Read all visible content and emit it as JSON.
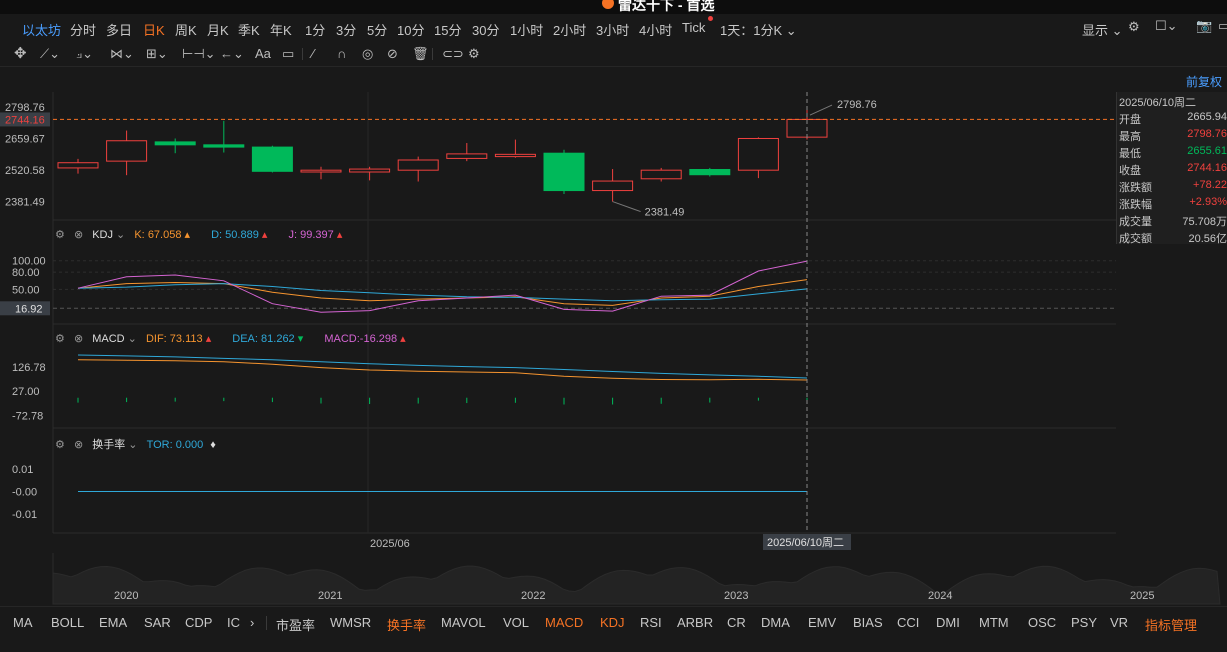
{
  "window": {
    "title": "雷达十下 - 首选"
  },
  "period_bar": {
    "symbol": "以太坊",
    "items": [
      "分时",
      "多日",
      "日K",
      "周K",
      "月K",
      "季K",
      "年K",
      "1分",
      "3分",
      "5分",
      "10分",
      "15分",
      "30分",
      "1小时",
      "2小时",
      "3小时",
      "4小时",
      "Tick"
    ],
    "active": "日K",
    "sync": "1天：1分K",
    "display": "显示"
  },
  "toolbar": {
    "icons": [
      "move-icon",
      "line-icon",
      "trend-icon",
      "wave-icon",
      "fib-icon",
      "measure-icon",
      "arrow-icon",
      "text-icon",
      "comment-icon",
      "pen-icon",
      "magnet-icon",
      "eye-icon",
      "hide-icon",
      "delete-icon",
      "link-icon",
      "settings-icon"
    ]
  },
  "main_chart": {
    "adjust_label": "前复权",
    "price_labels": [
      "2798.76",
      "2744.16",
      "2659.67",
      "2520.58",
      "2381.49"
    ],
    "current_price": "2744.16",
    "high_label": "2798.76",
    "low_label": "2381.49",
    "colors": {
      "up": "#f0413e",
      "down": "#00b95a",
      "background": "#191919"
    }
  },
  "chart_data": [
    {
      "type": "candlestick",
      "title": "",
      "ylim": [
        2300,
        2830
      ],
      "candles": [
        {
          "o": 2530,
          "h": 2570,
          "l": 2505,
          "c": 2553
        },
        {
          "o": 2560,
          "h": 2695,
          "l": 2498,
          "c": 2650
        },
        {
          "o": 2645,
          "h": 2660,
          "l": 2595,
          "c": 2632
        },
        {
          "o": 2632,
          "h": 2738,
          "l": 2598,
          "c": 2622
        },
        {
          "o": 2622,
          "h": 2628,
          "l": 2510,
          "c": 2515
        },
        {
          "o": 2512,
          "h": 2535,
          "l": 2480,
          "c": 2520
        },
        {
          "o": 2512,
          "h": 2535,
          "l": 2475,
          "c": 2525
        },
        {
          "o": 2520,
          "h": 2580,
          "l": 2470,
          "c": 2565
        },
        {
          "o": 2572,
          "h": 2640,
          "l": 2560,
          "c": 2592
        },
        {
          "o": 2580,
          "h": 2655,
          "l": 2575,
          "c": 2590
        },
        {
          "o": 2595,
          "h": 2610,
          "l": 2415,
          "c": 2430
        },
        {
          "o": 2430,
          "h": 2525,
          "l": 2381.49,
          "c": 2472
        },
        {
          "o": 2482,
          "h": 2530,
          "l": 2470,
          "c": 2520
        },
        {
          "o": 2523,
          "h": 2530,
          "l": 2492,
          "c": 2500
        },
        {
          "o": 2520,
          "h": 2665,
          "l": 2485,
          "c": 2660
        },
        {
          "o": 2665.94,
          "h": 2798.76,
          "l": 2655.61,
          "c": 2744.16
        }
      ]
    },
    {
      "type": "line",
      "title": "KDJ",
      "ylim": [
        0,
        110
      ],
      "ticks": [
        "100.00",
        "80.00",
        "50.00",
        "16.92"
      ],
      "series": [
        {
          "name": "K",
          "color": "#f5942f",
          "values": [
            52,
            60,
            62,
            60,
            45,
            35,
            30,
            33,
            35,
            37,
            25,
            22,
            35,
            38,
            55,
            67.058
          ]
        },
        {
          "name": "D",
          "color": "#2fa8d8",
          "values": [
            52,
            54,
            58,
            60,
            55,
            48,
            44,
            40,
            37,
            36,
            33,
            30,
            32,
            33,
            42,
            50.889
          ]
        },
        {
          "name": "J",
          "color": "#d464d2",
          "values": [
            52,
            72,
            75,
            65,
            25,
            10,
            13,
            30,
            35,
            40,
            15,
            12,
            38,
            40,
            82,
            99.397
          ]
        }
      ]
    },
    {
      "type": "line",
      "title": "MACD",
      "ylim": [
        -100,
        180
      ],
      "ticks": [
        "126.78",
        "27.00",
        "-72.78"
      ],
      "series": [
        {
          "name": "DIF",
          "color": "#f5942f",
          "values": [
            156,
            154,
            152,
            148,
            138,
            124,
            114,
            109,
            106,
            103,
            88,
            80,
            75,
            74,
            76,
            73.113
          ]
        },
        {
          "name": "DEA",
          "color": "#2fa8d8",
          "values": [
            176,
            172,
            168,
            162,
            156,
            148,
            140,
            133,
            128,
            124,
            116,
            108,
            100,
            94,
            88,
            81.262
          ]
        },
        {
          "name": "MACD",
          "color": "#d464d2",
          "values": [
            -20,
            -18,
            -16,
            -14,
            -18,
            -24,
            -26,
            -24,
            -22,
            -21,
            -28,
            -28,
            -25,
            -20,
            -12,
            -16.298
          ]
        }
      ]
    },
    {
      "type": "line",
      "title": "换手率",
      "ylim": [
        -0.015,
        0.015
      ],
      "ticks": [
        "0.01",
        "-0.00",
        "-0.01"
      ],
      "series": [
        {
          "name": "TOR",
          "color": "#2fa8d8",
          "values": [
            0,
            0,
            0,
            0,
            0,
            0,
            0,
            0,
            0,
            0,
            0,
            0,
            0,
            0,
            0,
            0
          ]
        }
      ]
    }
  ],
  "kdj": {
    "name": "KDJ",
    "k_label": "K:",
    "k": "67.058",
    "d_label": "D:",
    "d": "50.889",
    "j_label": "J:",
    "j": "99.397"
  },
  "macd": {
    "name": "MACD",
    "dif_label": "DIF:",
    "dif": "73.113",
    "dea_label": "DEA:",
    "dea": "81.262",
    "macd_label": "MACD:",
    "macd": "-16.298"
  },
  "tor": {
    "name": "换手率",
    "label": "TOR:",
    "value": "0.000"
  },
  "x_axis": {
    "label1": "2025/06",
    "cursor_date": "2025/06/10周二"
  },
  "overview_years": [
    "2020",
    "2021",
    "2022",
    "2023",
    "2024",
    "2025"
  ],
  "info_panel": {
    "date": "2025/06/10周二",
    "rows": [
      {
        "label": "开盘",
        "value": "2665.94",
        "color": "#c8c8c8"
      },
      {
        "label": "最高",
        "value": "2798.76",
        "color": "#f0413e"
      },
      {
        "label": "最低",
        "value": "2655.61",
        "color": "#00b95a"
      },
      {
        "label": "收盘",
        "value": "2744.16",
        "color": "#f0413e"
      },
      {
        "label": "涨跌额",
        "value": "+78.22",
        "color": "#f0413e"
      },
      {
        "label": "涨跌幅",
        "value": "+2.93%",
        "color": "#f0413e"
      },
      {
        "label": "成交量",
        "value": "75.708万",
        "color": "#c8c8c8"
      },
      {
        "label": "成交额",
        "value": "20.56亿",
        "color": "#c8c8c8"
      }
    ]
  },
  "indicator_bar": {
    "items": [
      "MA",
      "BOLL",
      "EMA",
      "SAR",
      "CDP",
      "IC",
      "市盈率",
      "WMSR",
      "换手率",
      "MAVOL",
      "VOL",
      "MACD",
      "KDJ",
      "RSI",
      "ARBR",
      "CR",
      "DMA",
      "EMV",
      "BIAS",
      "CCI",
      "DMI",
      "MTM",
      "OSC",
      "PSY",
      "VR",
      "指标管理"
    ],
    "active": [
      "换手率",
      "MACD",
      "KDJ",
      "指标管理"
    ]
  }
}
